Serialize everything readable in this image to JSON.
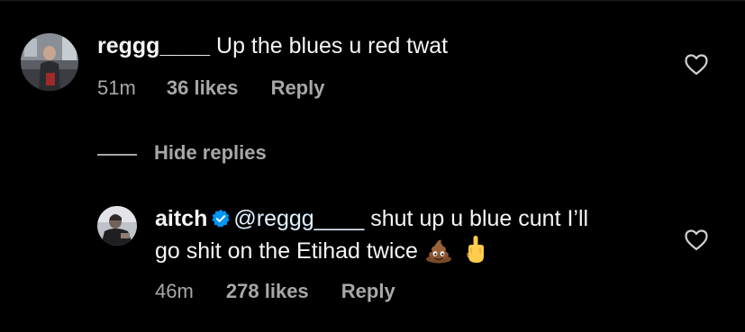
{
  "comment": {
    "username": "reggg____",
    "text": "Up the blues u red twat",
    "time": "51m",
    "likes": "36 likes",
    "reply_label": "Reply"
  },
  "hide_replies_label": "Hide replies",
  "reply": {
    "username": "aitch",
    "mention": "@reggg____",
    "text_line1": " shut up u blue cunt I’ll",
    "text_line2": "go shit on the Etihad twice ",
    "emoji_1": "pile-of-poo",
    "emoji_2": "middle-finger",
    "time": "46m",
    "likes": "278 likes",
    "reply_label": "Reply"
  },
  "colors": {
    "background": "#000000",
    "primary_text": "#f5f5f5",
    "secondary_text": "#a8a8a8",
    "mention": "#e0f1ff",
    "verified_badge": "#0095f6"
  },
  "icons": [
    "heart-icon",
    "verified-badge-icon"
  ]
}
